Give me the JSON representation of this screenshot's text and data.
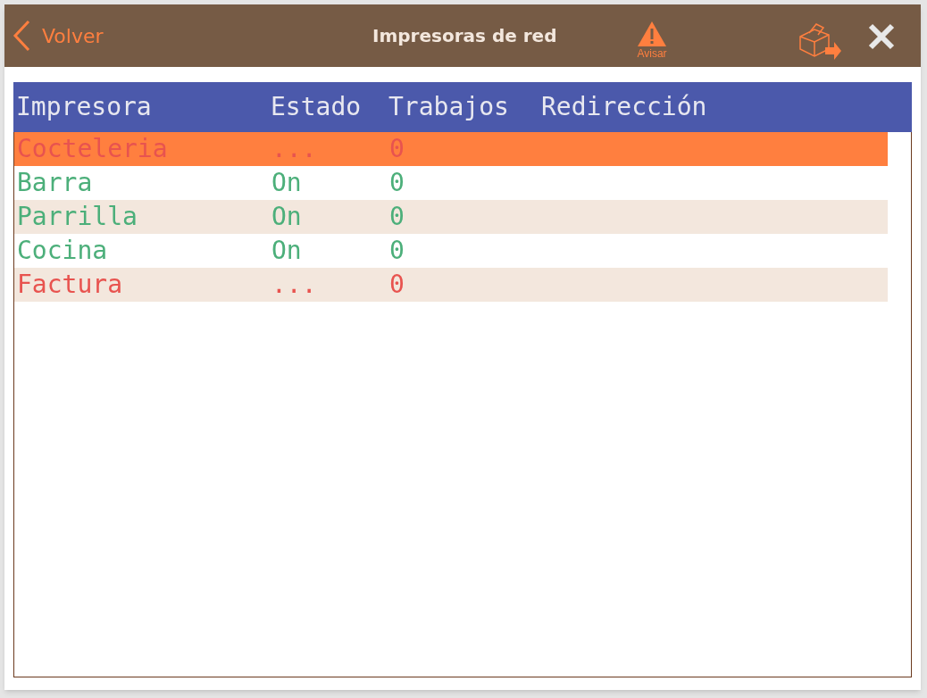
{
  "header": {
    "back": "Volver",
    "title": "Impresoras de red",
    "warn": "Avisar"
  },
  "table": {
    "columns": [
      "Impresora",
      "Estado",
      "Trabajos",
      "Redirección"
    ],
    "rows": [
      {
        "name": "Cocteleria",
        "status": "...",
        "jobs": "0",
        "color": "#e8534f",
        "selected": true
      },
      {
        "name": "Barra",
        "status": "On",
        "jobs": "0",
        "color": "#4caf7a",
        "selected": false
      },
      {
        "name": "Parrilla",
        "status": "On",
        "jobs": "0",
        "color": "#4caf7a",
        "selected": false
      },
      {
        "name": "Cocina",
        "status": "On",
        "jobs": "0",
        "color": "#4caf7a",
        "selected": false
      },
      {
        "name": "Factura",
        "status": "...",
        "jobs": "0",
        "color": "#e8534f",
        "selected": false
      }
    ]
  }
}
